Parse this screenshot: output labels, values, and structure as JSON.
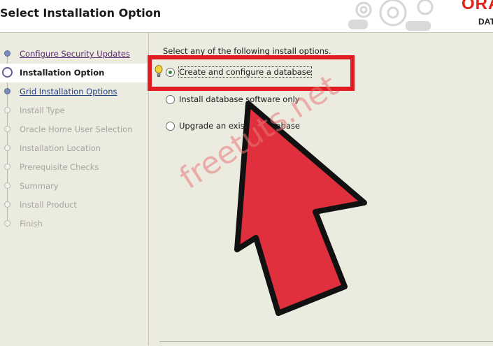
{
  "header": {
    "title": "Select Installation Option",
    "brand": "ORA",
    "brand_sub": "DAT"
  },
  "sidebar": {
    "steps": [
      {
        "label": "Configure Security Updates",
        "state": "done"
      },
      {
        "label": "Installation Option",
        "state": "current"
      },
      {
        "label": "Grid Installation Options",
        "state": "link"
      },
      {
        "label": "Install Type",
        "state": "todo"
      },
      {
        "label": "Oracle Home User Selection",
        "state": "todo"
      },
      {
        "label": "Installation Location",
        "state": "todo"
      },
      {
        "label": "Prerequisite Checks",
        "state": "todo"
      },
      {
        "label": "Summary",
        "state": "todo"
      },
      {
        "label": "Install Product",
        "state": "todo"
      },
      {
        "label": "Finish",
        "state": "todo"
      }
    ]
  },
  "main": {
    "prompt": "Select any of the following install options.",
    "options": [
      {
        "label": "Create and configure a database",
        "selected": true
      },
      {
        "label": "Install database software only",
        "selected": false
      },
      {
        "label": "Upgrade an existing database",
        "selected": false
      }
    ]
  },
  "overlay": {
    "watermark": "freetuts.net",
    "highlight_color": "#e11b22",
    "arrow_color": "#e0303d"
  },
  "icons": {
    "hint": "lightbulb-icon",
    "gears": "gears-icon"
  }
}
